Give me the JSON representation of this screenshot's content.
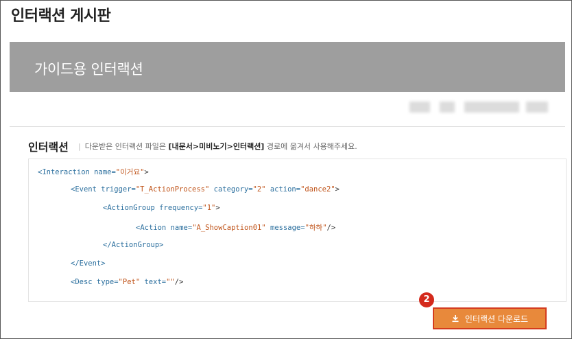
{
  "board": {
    "title": "인터랙션 게시판"
  },
  "post": {
    "title": "가이드용 인터랙션"
  },
  "section": {
    "heading": "인터랙션",
    "desc_prefix": "다운받은 인터랙션 파일은 ",
    "desc_path": "[내문서>미비노기>인터랙션]",
    "desc_suffix": " 경로에 옮겨서 사용해주세요."
  },
  "code": {
    "l1_tag": "<Interaction",
    "l1_attr": " name=",
    "l1_val": "\"이거요\"",
    "l1_end": ">",
    "l2_tag": "<Event",
    "l2_a1": " trigger=",
    "l2_v1": "\"T_ActionProcess\"",
    "l2_a2": " category=",
    "l2_v2": "\"2\"",
    "l2_a3": " action=",
    "l2_v3": "\"dance2\"",
    "l2_end": ">",
    "l3_tag": "<ActionGroup",
    "l3_attr": " frequency=",
    "l3_val": "\"1\"",
    "l3_end": ">",
    "l4_tag": "<Action",
    "l4_a1": " name=",
    "l4_v1": "\"A_ShowCaption01\"",
    "l4_a2": " message=",
    "l4_v2": "\"하하\"",
    "l4_end": "/>",
    "l5": "</ActionGroup>",
    "l6": "</Event>",
    "l7_tag": "<Desc",
    "l7_a1": " type=",
    "l7_v1": "\"Pet\"",
    "l7_a2": " text=",
    "l7_v2": "\"\"",
    "l7_end": "/>"
  },
  "badge": {
    "number": "2"
  },
  "download": {
    "label": "인터랙션 다운로드",
    "icon": "download-icon"
  }
}
